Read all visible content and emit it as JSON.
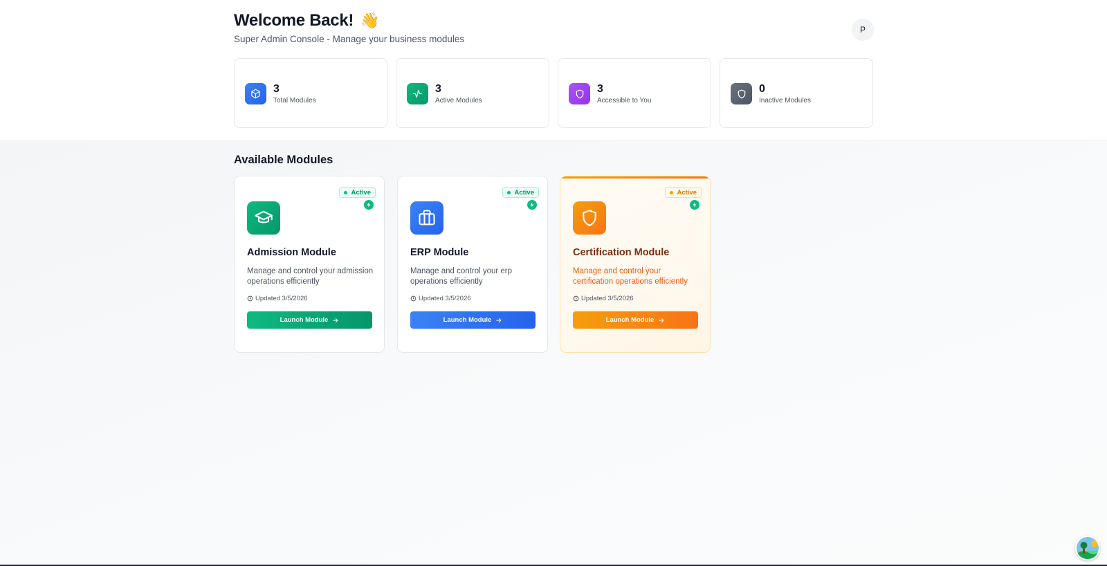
{
  "header": {
    "title": "Welcome Back!",
    "wave_emoji": "👋",
    "subtitle": "Super Admin Console - Manage your business modules",
    "avatar_initial": "P"
  },
  "stats": [
    {
      "value": "3",
      "label": "Total Modules",
      "icon": "cube-icon",
      "color": "#3b82f6"
    },
    {
      "value": "3",
      "label": "Active Modules",
      "icon": "activity-icon",
      "color": "#10b981"
    },
    {
      "value": "3",
      "label": "Accessible to You",
      "icon": "shield-icon",
      "color": "#a855f7"
    },
    {
      "value": "0",
      "label": "Inactive Modules",
      "icon": "shield-icon",
      "color": "#4b5563"
    }
  ],
  "section_title": "Available Modules",
  "modules": [
    {
      "name": "Admission Module",
      "description": "Manage and control your admission operations efficiently",
      "status": "Active",
      "updated": "Updated 3/5/2026",
      "button_label": "Launch Module",
      "icon": "graduation-cap-icon",
      "color": "#10b981"
    },
    {
      "name": "ERP Module",
      "description": "Manage and control your erp operations efficiently",
      "status": "Active",
      "updated": "Updated 3/5/2026",
      "button_label": "Launch Module",
      "icon": "briefcase-icon",
      "color": "#3b82f6"
    },
    {
      "name": "Certification Module",
      "description": "Manage and control your certification operations efficiently",
      "status": "Active",
      "updated": "Updated 3/5/2026",
      "button_label": "Launch Module",
      "icon": "shield-icon",
      "color": "#f59e0b"
    }
  ]
}
